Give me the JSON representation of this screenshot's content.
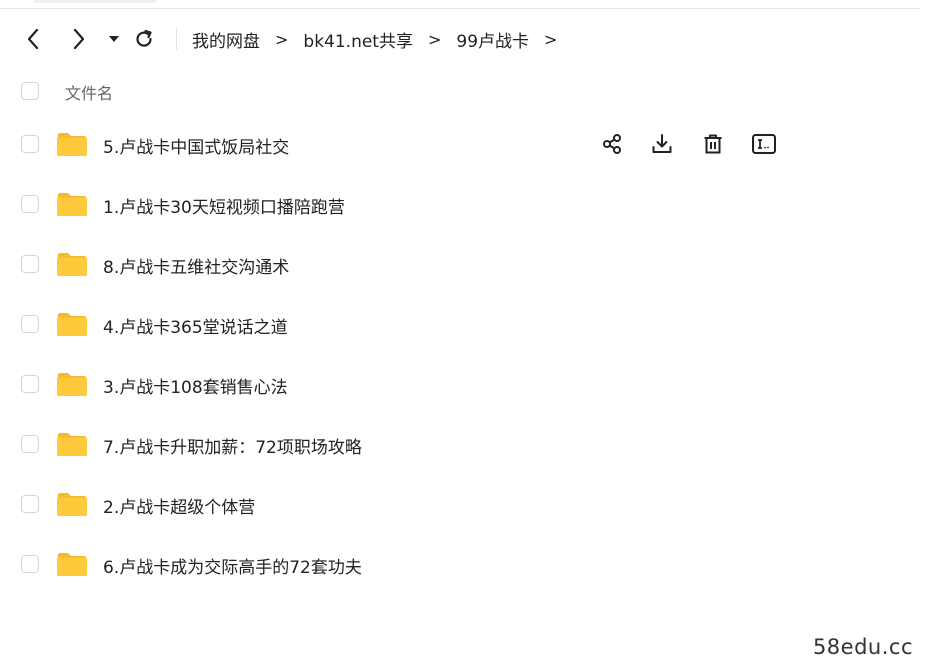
{
  "breadcrumb": {
    "items": [
      "我的网盘",
      "bk41.net共享",
      "99卢战卡"
    ],
    "separator": ">"
  },
  "list_header": {
    "name_column": "文件名"
  },
  "files": [
    {
      "name": "5.卢战卡中国式饭局社交",
      "type": "folder"
    },
    {
      "name": "1.卢战卡30天短视频口播陪跑营",
      "type": "folder"
    },
    {
      "name": "8.卢战卡五维社交沟通术",
      "type": "folder"
    },
    {
      "name": "4.卢战卡365堂说话之道",
      "type": "folder"
    },
    {
      "name": "3.卢战卡108套销售心法",
      "type": "folder"
    },
    {
      "name": "7.卢战卡升职加薪：72项职场攻略",
      "type": "folder"
    },
    {
      "name": "2.卢战卡超级个体营",
      "type": "folder"
    },
    {
      "name": "6.卢战卡成为交际高手的72套功夫",
      "type": "folder"
    }
  ],
  "row_actions": [
    "share-icon",
    "download-icon",
    "delete-icon",
    "rename-icon"
  ],
  "watermark": "58edu.cc",
  "colors": {
    "folder": "#FFC93C",
    "folder_tab": "#F5B82E",
    "checkbox_border": "#d6d6d6"
  }
}
